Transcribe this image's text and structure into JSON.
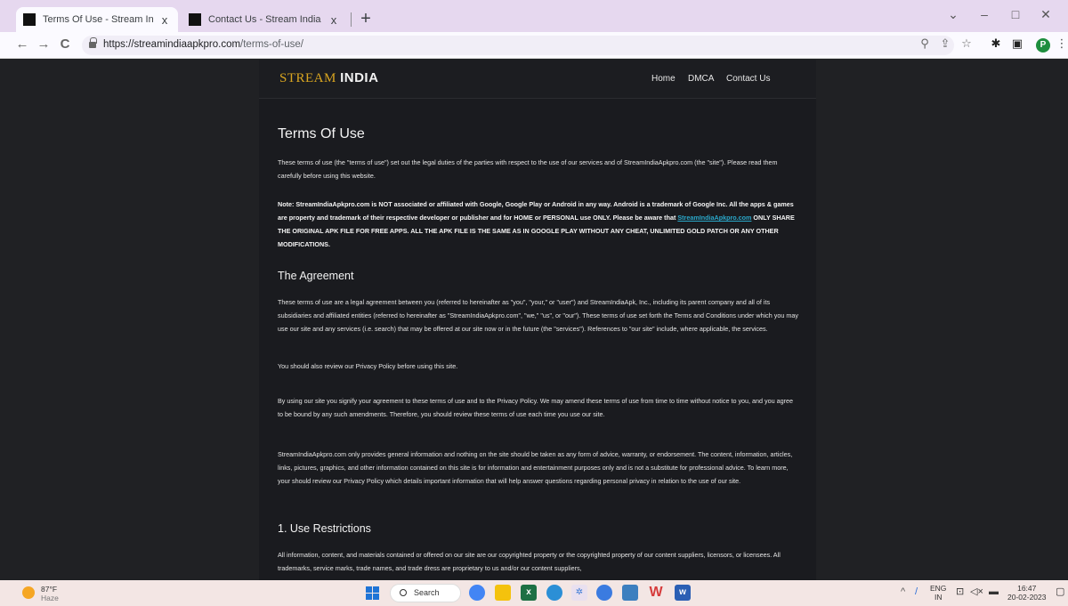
{
  "browser": {
    "tabs": [
      {
        "title": "Terms Of Use - Stream India Apk",
        "active": true,
        "close": "x"
      },
      {
        "title": "Contact Us - Stream India Apk Do",
        "active": false,
        "close": "x"
      }
    ],
    "new_tab": "+",
    "window_controls": {
      "dropdown": "⌄",
      "minimize": "–",
      "maximize": "□",
      "close": "✕"
    },
    "nav": {
      "back": "←",
      "forward": "→",
      "reload": "C"
    },
    "url": {
      "host": "https://streamindiaapkpro.com",
      "path": "/terms-of-use/"
    },
    "toolbar_icons": [
      "zoom-icon",
      "share-icon",
      "star-icon",
      "extensions-icon",
      "sidepanel-icon",
      "profile-icon",
      "menu-icon"
    ],
    "profile_initial": "P"
  },
  "site": {
    "logo_part1": "STREAM",
    "logo_part2": "INDIA",
    "menu": [
      "Home",
      "DMCA",
      "Contact Us"
    ],
    "accent_color": "#d9a521",
    "link_color": "#2aa7c9"
  },
  "article": {
    "title": "Terms Of Use",
    "intro": "These terms of use (the \"terms of use\") set out the legal duties of the parties with respect to the use of our services and of StreamIndiaApkpro.com (the \"site\"). Please read them carefully before using this website.",
    "note_before": "Note: StreamIndiaApkpro.com is NOT associated or affiliated with Google, Google Play or Android in any way. Android is a trademark of Google Inc. All the apps & games are property and trademark of their respective developer or publisher and for HOME or PERSONAL use ONLY. Please be aware that ",
    "note_link": "StreamIndiaApkpro.com",
    "note_after": " ONLY SHARE THE ORIGINAL APK FILE FOR FREE APPS. ALL THE APK FILE IS THE SAME AS IN GOOGLE PLAY WITHOUT ANY CHEAT, UNLIMITED GOLD PATCH OR ANY OTHER MODIFICATIONS.",
    "h_agreement": "The Agreement",
    "p_agreement": "These terms of use are a legal agreement between you (referred to hereinafter as \"you\", \"your,\" or \"user\") and StreamIndiaApk, Inc., including its parent company and all of its subsidiaries and affiliated entities (referred to hereinafter as \"StreamIndiaApkpro.com\", \"we,\" \"us\", or \"our\"). These terms of use set forth the Terms and Conditions under which you may use our site and any services (i.e. search) that may be offered at our site now or in the future (the \"services\"). References to \"our site\" include, where applicable, the services.",
    "p_privacy": "You should also review our Privacy Policy before using this site.",
    "p_using": "By using our site you signify your agreement to these terms of use and to the Privacy Policy. We may amend these terms of use from time to time without notice to you, and you agree to be bound by any such amendments. Therefore, you should review these terms of use each time you use our site.",
    "p_info": "StreamIndiaApkpro.com only provides general information and nothing on the site should be taken as any form of advice, warranty, or endorsement. The content, information, articles, links, pictures, graphics, and other information contained on this site is for information and entertainment purposes only and is not a substitute for professional advice. To learn more, your should review our Privacy Policy which details important information that will help answer questions regarding personal privacy in relation to the use of our site.",
    "h_restrictions": "1. Use Restrictions",
    "p_restrictions": "All information, content, and materials contained or offered on our site are our copyrighted property or the copyrighted property of our content suppliers, licensors, or licensees. All trademarks, service marks, trade names, and trade dress are proprietary to us and/or our content suppliers,"
  },
  "taskbar": {
    "temperature": "87°F",
    "weather": "Haze",
    "search": "Search",
    "apps": [
      "chrome-icon",
      "file-explorer-icon",
      "excel-icon",
      "edge-icon",
      "settings-icon",
      "chrome-dev-icon",
      "photos-icon",
      "wps-icon",
      "word-icon"
    ],
    "lang1": "ENG",
    "lang2": "IN",
    "time": "16:47",
    "date": "20-02-2023"
  }
}
